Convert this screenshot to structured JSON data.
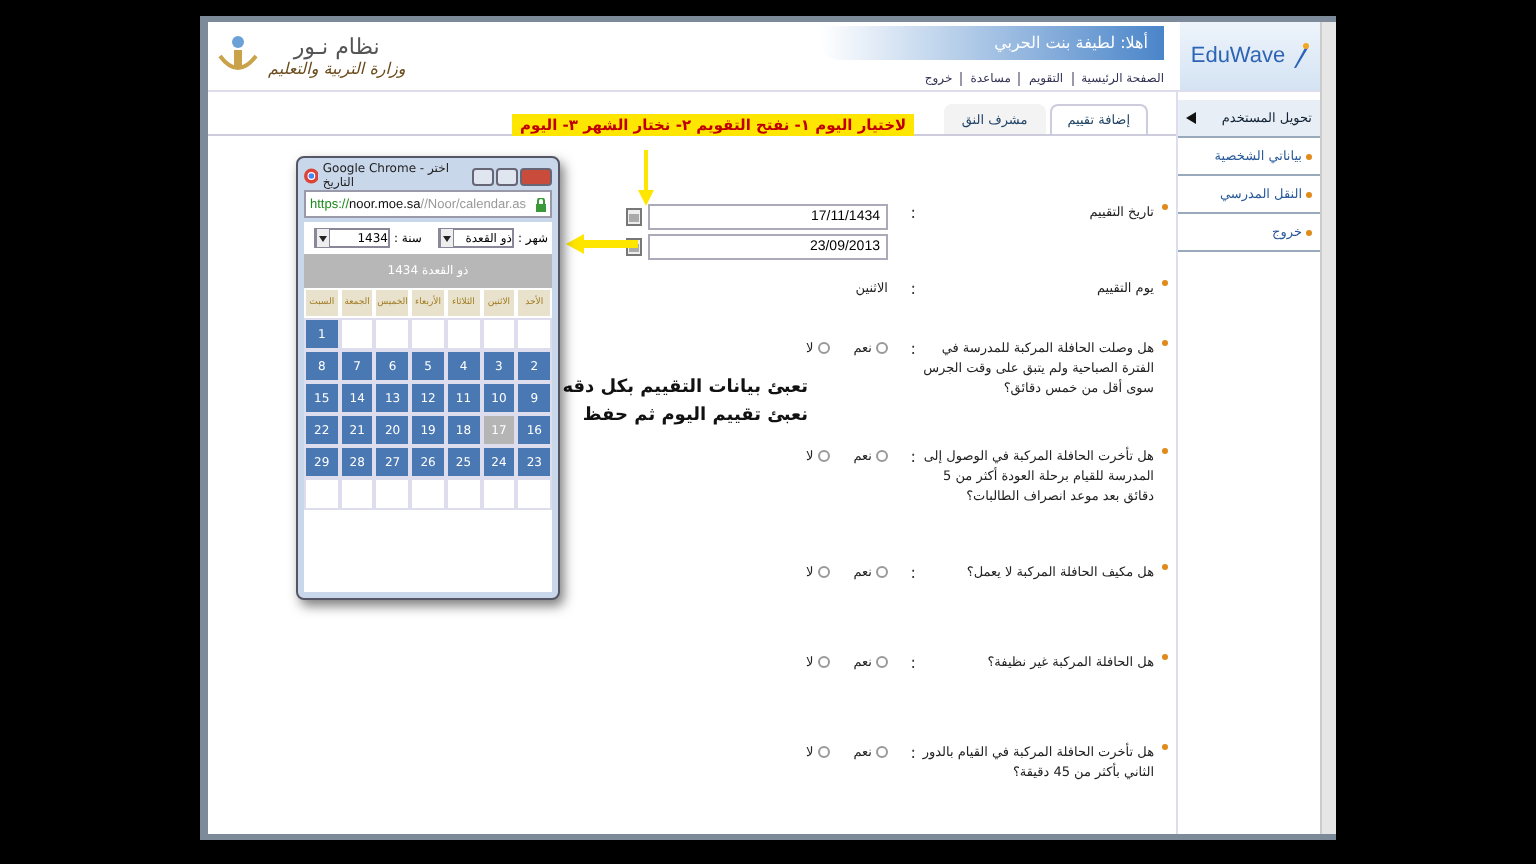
{
  "header": {
    "brand": "EduWave",
    "logo_title": "نظام نـور",
    "logo_subtitle": "وزارة التربية والتعليم",
    "greeting": "أهلا: لطيفة بنت الحربي",
    "links": [
      "الصفحة الرئيسية",
      "التقويم",
      "مساعدة",
      "خروج"
    ]
  },
  "sidebar": {
    "items": [
      {
        "label": "تحويل المستخدم",
        "kind": "header"
      },
      {
        "label": "بياناتي الشخصية",
        "kind": "link"
      },
      {
        "label": "النقل المدرسي",
        "kind": "link"
      },
      {
        "label": "خروج",
        "kind": "link"
      }
    ]
  },
  "tabs": [
    {
      "label": "إضافة تقييم",
      "selected": true
    },
    {
      "label": "مشرف النق",
      "selected": false
    }
  ],
  "form": {
    "colon": ":",
    "date_label": "تاريخ التقييم",
    "hijri_date": "17/11/1434",
    "gregorian_date": "23/09/2013",
    "day_label": "يوم التقييم",
    "day_value": "الاثنين",
    "questions": [
      {
        "text": "هل وصلت الحافلة المركبة للمدرسة في الفترة الصباحية ولم يتبق على وقت الجرس سوى أقل من خمس دقائق؟",
        "options": [
          {
            "label": "نعم",
            "selected": false
          },
          {
            "label": "لا",
            "selected": false
          }
        ]
      },
      {
        "text": "هل تأخرت الحافلة المركبة في الوصول إلى المدرسة للقيام برحلة العودة أكثر من 5 دقائق بعد موعد انصراف الطالبات؟",
        "options": [
          {
            "label": "نعم",
            "selected": false
          },
          {
            "label": "لا",
            "selected": false
          }
        ]
      },
      {
        "text": "هل مكيف الحافلة المركبة لا يعمل؟",
        "options": [
          {
            "label": "نعم",
            "selected": false
          },
          {
            "label": "لا",
            "selected": false
          }
        ]
      },
      {
        "text": "هل الحافلة المركبة غير نظيفة؟",
        "options": [
          {
            "label": "نعم",
            "selected": false
          },
          {
            "label": "لا",
            "selected": false
          }
        ]
      },
      {
        "text": "هل تأخرت الحافلة المركبة في القيام بالدور الثاني بأكثر من 45 دقيقة؟",
        "options": [
          {
            "label": "نعم",
            "selected": false
          },
          {
            "label": "لا",
            "selected": false
          }
        ]
      }
    ]
  },
  "annotations": {
    "banner": "لاختيار اليوم ١- نفتح التقويم ٢- نختار الشهر ٣- اليوم",
    "note_lines": [
      "تعبئ بيانات التقييم بكل دقه",
      "نعبئ تقييم اليوم ثم حفظ"
    ]
  },
  "popup": {
    "title": "Google Chrome - اختر التاريخ",
    "url_scheme": "https://",
    "url_host": "noor.moe.sa",
    "url_path": "//Noor/calendar.as",
    "month_label": "شهر :",
    "month_value": "ذو القعدة",
    "year_label": "سنة :",
    "year_value": "1434",
    "caption": "ذو القعدة 1434",
    "weekdays": [
      "الأحد",
      "الاثنين",
      "الثلاثاء",
      "الأربعاء",
      "الخميس",
      "الجمعة",
      "السبت"
    ],
    "weeks": [
      [
        {
          "day": "1",
          "selected": false
        }
      ],
      [
        {
          "day": "2",
          "selected": false
        },
        {
          "day": "3",
          "selected": false
        },
        {
          "day": "4",
          "selected": false
        },
        {
          "day": "5",
          "selected": false
        },
        {
          "day": "6",
          "selected": false
        },
        {
          "day": "7",
          "selected": false
        },
        {
          "day": "8",
          "selected": false
        }
      ],
      [
        {
          "day": "9",
          "selected": false
        },
        {
          "day": "10",
          "selected": false
        },
        {
          "day": "11",
          "selected": false
        },
        {
          "day": "12",
          "selected": false
        },
        {
          "day": "13",
          "selected": false
        },
        {
          "day": "14",
          "selected": false
        },
        {
          "day": "15",
          "selected": false
        }
      ],
      [
        {
          "day": "16",
          "selected": false
        },
        {
          "day": "17",
          "selected": true
        },
        {
          "day": "18",
          "selected": false
        },
        {
          "day": "19",
          "selected": false
        },
        {
          "day": "20",
          "selected": false
        },
        {
          "day": "21",
          "selected": false
        },
        {
          "day": "22",
          "selected": false
        }
      ],
      [
        {
          "day": "23",
          "selected": false
        },
        {
          "day": "24",
          "selected": false
        },
        {
          "day": "25",
          "selected": false
        },
        {
          "day": "26",
          "selected": false
        },
        {
          "day": "27",
          "selected": false
        },
        {
          "day": "28",
          "selected": false
        },
        {
          "day": "29",
          "selected": false
        }
      ]
    ]
  }
}
